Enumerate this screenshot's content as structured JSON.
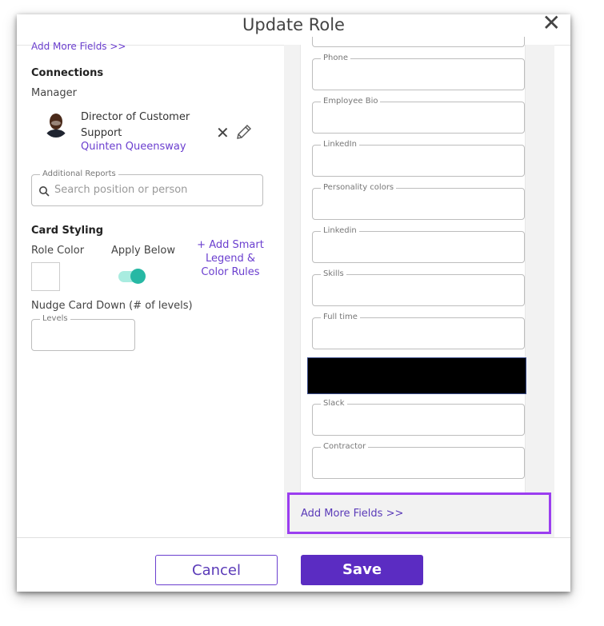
{
  "dialog": {
    "title": "Update Role",
    "close_icon": "close-icon"
  },
  "left": {
    "add_more_top": "Add More Fields >>",
    "connections_heading": "Connections",
    "manager_label": "Manager",
    "manager": {
      "title": "Director of Customer Support",
      "name": "Quinten Queensway",
      "remove_icon": "close-icon",
      "edit_icon": "pencil-icon"
    },
    "additional_reports": {
      "legend": "Additional Reports",
      "placeholder": "Search position or person"
    },
    "card_styling": {
      "heading": "Card Styling",
      "role_color_label": "Role Color",
      "apply_below_label": "Apply Below",
      "apply_below_on": true,
      "smart_rules": "+ Add Smart Legend & Color Rules",
      "nudge_label": "Nudge Card Down (# of levels)",
      "levels_legend": "Levels"
    }
  },
  "right": {
    "fields": [
      "Phone",
      "Employee Bio",
      "LinkedIn",
      "Personality colors",
      "Linkedin",
      "Skills",
      "Full time",
      "Slack",
      "Contractor"
    ],
    "add_more_bottom": "Add More Fields >>"
  },
  "footer": {
    "cancel": "Cancel",
    "save": "Save"
  },
  "colors": {
    "accent": "#5b2cc2",
    "link": "#6b3fcf",
    "toggle": "#27b8a4",
    "highlight": "#9b3ef0"
  }
}
